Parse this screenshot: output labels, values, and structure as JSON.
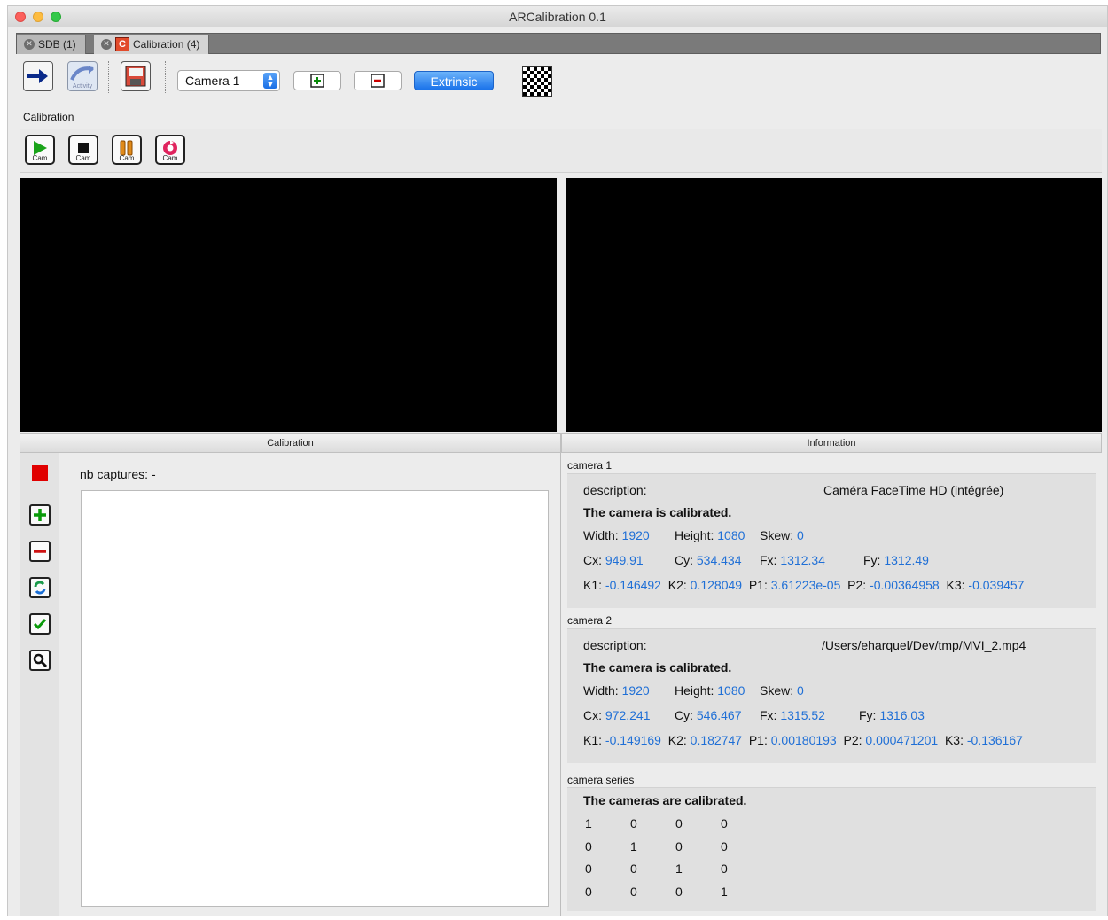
{
  "window": {
    "title": "ARCalibration 0.1"
  },
  "tabs": [
    {
      "label": "SDB (1)"
    },
    {
      "label": "Calibration (4)",
      "icon_letter": "C"
    }
  ],
  "toolbar": {
    "activity_label": "Activity",
    "camera_select": "Camera 1",
    "extrinsic_label": "Extrinsic"
  },
  "calibration_section": {
    "title": "Calibration",
    "buttons": [
      {
        "icon": "play-icon",
        "label": "Cam"
      },
      {
        "icon": "stop-icon",
        "label": "Cam"
      },
      {
        "icon": "pause-icon",
        "label": "Cam"
      },
      {
        "icon": "record-icon",
        "label": "Cam"
      }
    ]
  },
  "calibration_panel": {
    "header": "Calibration",
    "nb_captures_label": "nb captures:",
    "nb_captures_value": "-"
  },
  "info_panel": {
    "header": "Information",
    "camera1": {
      "title": "camera 1",
      "description_label": "description:",
      "description_value": "Caméra FaceTime HD (intégrée)",
      "status": "The camera is calibrated.",
      "width": "1920",
      "height": "1080",
      "skew": "0",
      "cx": "949.91",
      "cy": "534.434",
      "fx": "1312.34",
      "fy": "1312.49",
      "k1": "-0.146492",
      "k2": "0.128049",
      "p1": "3.61223e-05",
      "p2": "-0.00364958",
      "k3": "-0.039457"
    },
    "camera2": {
      "title": "camera 2",
      "description_label": "description:",
      "description_value": "/Users/eharquel/Dev/tmp/MVI_2.mp4",
      "status": "The camera is calibrated.",
      "width": "1920",
      "height": "1080",
      "skew": "0",
      "cx": "972.241",
      "cy": "546.467",
      "fx": "1315.52",
      "fy": "1316.03",
      "k1": "-0.149169",
      "k2": "0.182747",
      "p1": "0.00180193",
      "p2": "0.000471201",
      "k3": "-0.136167"
    },
    "labels": {
      "width": "Width:",
      "height": "Height:",
      "skew": "Skew:",
      "cx": "Cx:",
      "cy": "Cy:",
      "fx": "Fx:",
      "fy": "Fy:",
      "k1": "K1:",
      "k2": "K2:",
      "p1": "P1:",
      "p2": "P2:",
      "k3": "K3:"
    },
    "series": {
      "title": "camera series",
      "status": "The cameras are calibrated.",
      "matrix": [
        [
          "1",
          "0",
          "0",
          "0"
        ],
        [
          "0",
          "1",
          "0",
          "0"
        ],
        [
          "0",
          "0",
          "1",
          "0"
        ],
        [
          "0",
          "0",
          "0",
          "1"
        ]
      ]
    }
  },
  "colors": {
    "value_blue": "#1f6fd6",
    "accent_blue": "#1b73ea",
    "record_red": "#e00000"
  }
}
